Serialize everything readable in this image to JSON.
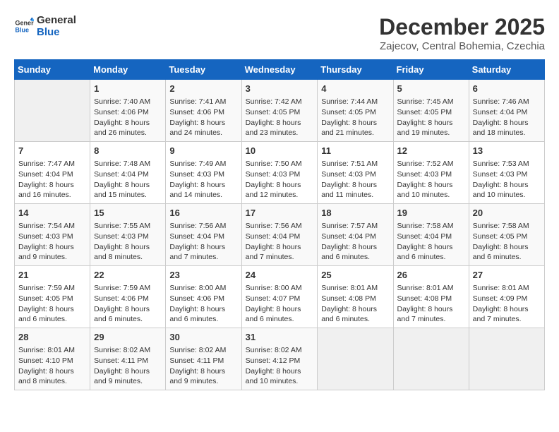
{
  "logo": {
    "line1": "General",
    "line2": "Blue"
  },
  "title": "December 2025",
  "location": "Zajecov, Central Bohemia, Czechia",
  "weekdays": [
    "Sunday",
    "Monday",
    "Tuesday",
    "Wednesday",
    "Thursday",
    "Friday",
    "Saturday"
  ],
  "weeks": [
    [
      {
        "day": "",
        "info": ""
      },
      {
        "day": "1",
        "info": "Sunrise: 7:40 AM\nSunset: 4:06 PM\nDaylight: 8 hours and 26 minutes."
      },
      {
        "day": "2",
        "info": "Sunrise: 7:41 AM\nSunset: 4:06 PM\nDaylight: 8 hours and 24 minutes."
      },
      {
        "day": "3",
        "info": "Sunrise: 7:42 AM\nSunset: 4:05 PM\nDaylight: 8 hours and 23 minutes."
      },
      {
        "day": "4",
        "info": "Sunrise: 7:44 AM\nSunset: 4:05 PM\nDaylight: 8 hours and 21 minutes."
      },
      {
        "day": "5",
        "info": "Sunrise: 7:45 AM\nSunset: 4:05 PM\nDaylight: 8 hours and 19 minutes."
      },
      {
        "day": "6",
        "info": "Sunrise: 7:46 AM\nSunset: 4:04 PM\nDaylight: 8 hours and 18 minutes."
      }
    ],
    [
      {
        "day": "7",
        "info": "Sunrise: 7:47 AM\nSunset: 4:04 PM\nDaylight: 8 hours and 16 minutes."
      },
      {
        "day": "8",
        "info": "Sunrise: 7:48 AM\nSunset: 4:04 PM\nDaylight: 8 hours and 15 minutes."
      },
      {
        "day": "9",
        "info": "Sunrise: 7:49 AM\nSunset: 4:03 PM\nDaylight: 8 hours and 14 minutes."
      },
      {
        "day": "10",
        "info": "Sunrise: 7:50 AM\nSunset: 4:03 PM\nDaylight: 8 hours and 12 minutes."
      },
      {
        "day": "11",
        "info": "Sunrise: 7:51 AM\nSunset: 4:03 PM\nDaylight: 8 hours and 11 minutes."
      },
      {
        "day": "12",
        "info": "Sunrise: 7:52 AM\nSunset: 4:03 PM\nDaylight: 8 hours and 10 minutes."
      },
      {
        "day": "13",
        "info": "Sunrise: 7:53 AM\nSunset: 4:03 PM\nDaylight: 8 hours and 10 minutes."
      }
    ],
    [
      {
        "day": "14",
        "info": "Sunrise: 7:54 AM\nSunset: 4:03 PM\nDaylight: 8 hours and 9 minutes."
      },
      {
        "day": "15",
        "info": "Sunrise: 7:55 AM\nSunset: 4:03 PM\nDaylight: 8 hours and 8 minutes."
      },
      {
        "day": "16",
        "info": "Sunrise: 7:56 AM\nSunset: 4:04 PM\nDaylight: 8 hours and 7 minutes."
      },
      {
        "day": "17",
        "info": "Sunrise: 7:56 AM\nSunset: 4:04 PM\nDaylight: 8 hours and 7 minutes."
      },
      {
        "day": "18",
        "info": "Sunrise: 7:57 AM\nSunset: 4:04 PM\nDaylight: 8 hours and 6 minutes."
      },
      {
        "day": "19",
        "info": "Sunrise: 7:58 AM\nSunset: 4:04 PM\nDaylight: 8 hours and 6 minutes."
      },
      {
        "day": "20",
        "info": "Sunrise: 7:58 AM\nSunset: 4:05 PM\nDaylight: 8 hours and 6 minutes."
      }
    ],
    [
      {
        "day": "21",
        "info": "Sunrise: 7:59 AM\nSunset: 4:05 PM\nDaylight: 8 hours and 6 minutes."
      },
      {
        "day": "22",
        "info": "Sunrise: 7:59 AM\nSunset: 4:06 PM\nDaylight: 8 hours and 6 minutes."
      },
      {
        "day": "23",
        "info": "Sunrise: 8:00 AM\nSunset: 4:06 PM\nDaylight: 8 hours and 6 minutes."
      },
      {
        "day": "24",
        "info": "Sunrise: 8:00 AM\nSunset: 4:07 PM\nDaylight: 8 hours and 6 minutes."
      },
      {
        "day": "25",
        "info": "Sunrise: 8:01 AM\nSunset: 4:08 PM\nDaylight: 8 hours and 6 minutes."
      },
      {
        "day": "26",
        "info": "Sunrise: 8:01 AM\nSunset: 4:08 PM\nDaylight: 8 hours and 7 minutes."
      },
      {
        "day": "27",
        "info": "Sunrise: 8:01 AM\nSunset: 4:09 PM\nDaylight: 8 hours and 7 minutes."
      }
    ],
    [
      {
        "day": "28",
        "info": "Sunrise: 8:01 AM\nSunset: 4:10 PM\nDaylight: 8 hours and 8 minutes."
      },
      {
        "day": "29",
        "info": "Sunrise: 8:02 AM\nSunset: 4:11 PM\nDaylight: 8 hours and 9 minutes."
      },
      {
        "day": "30",
        "info": "Sunrise: 8:02 AM\nSunset: 4:11 PM\nDaylight: 8 hours and 9 minutes."
      },
      {
        "day": "31",
        "info": "Sunrise: 8:02 AM\nSunset: 4:12 PM\nDaylight: 8 hours and 10 minutes."
      },
      {
        "day": "",
        "info": ""
      },
      {
        "day": "",
        "info": ""
      },
      {
        "day": "",
        "info": ""
      }
    ]
  ]
}
